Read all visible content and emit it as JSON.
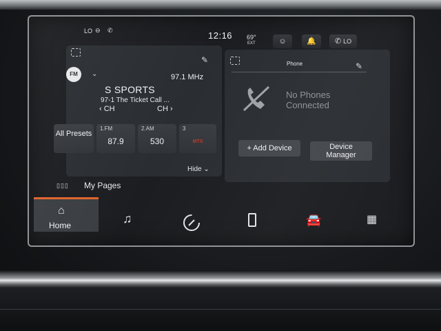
{
  "status_bar": {
    "left_indicator": "LO",
    "time": "12:16",
    "temperature": "69°",
    "temperature_label": "EXT",
    "right_indicator": "LO"
  },
  "radio": {
    "band": "FM",
    "frequency": "97.1 MHz",
    "station_name": "S SPORTS",
    "song_info": "97-1 The Ticket Call ...",
    "ch_prev_label": "CH",
    "ch_next_label": "CH",
    "presets": [
      {
        "label": "All Presets",
        "num": "",
        "value": ""
      },
      {
        "num": "1.FM",
        "value": "87.9"
      },
      {
        "num": "2.AM",
        "value": "530"
      },
      {
        "num": "3",
        "value": "",
        "logo": "MTS"
      }
    ],
    "hide_label": "Hide"
  },
  "phone": {
    "title": "Phone",
    "status_line1": "No Phones",
    "status_line2": "Connected",
    "add_device_label": "+ Add Device",
    "device_manager_line1": "Device",
    "device_manager_line2": "Manager"
  },
  "my_pages": {
    "label": "My Pages"
  },
  "nav": {
    "items": [
      {
        "name": "home",
        "label": "Home",
        "icon": "house-icon",
        "active": true
      },
      {
        "name": "media",
        "label": "",
        "icon": "music-note-icon"
      },
      {
        "name": "comfort",
        "label": "",
        "icon": "gauge-icon"
      },
      {
        "name": "phone",
        "label": "",
        "icon": "smartphone-icon"
      },
      {
        "name": "vehicle",
        "label": "",
        "icon": "car-icon"
      },
      {
        "name": "apps",
        "label": "",
        "icon": "grid-icon"
      }
    ]
  },
  "colors": {
    "accent": "#e2632b",
    "screen_bg": "#1b1d20",
    "card_bg": "#2a2d31"
  }
}
